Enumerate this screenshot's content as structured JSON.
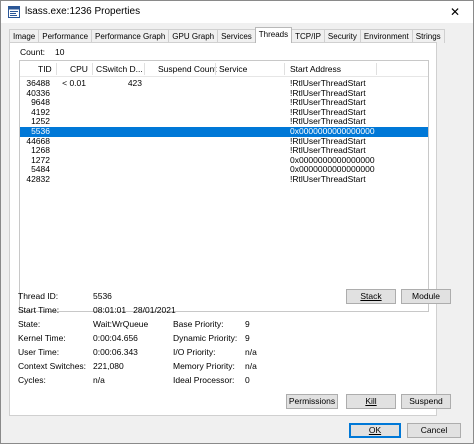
{
  "window": {
    "title": "lsass.exe:1236 Properties",
    "close_glyph": "✕"
  },
  "tabs": [
    {
      "label": "Image",
      "active": false
    },
    {
      "label": "Performance",
      "active": false
    },
    {
      "label": "Performance Graph",
      "active": false
    },
    {
      "label": "GPU Graph",
      "active": false
    },
    {
      "label": "Services",
      "active": false
    },
    {
      "label": "Threads",
      "active": true
    },
    {
      "label": "TCP/IP",
      "active": false
    },
    {
      "label": "Security",
      "active": false
    },
    {
      "label": "Environment",
      "active": false
    },
    {
      "label": "Strings",
      "active": false
    }
  ],
  "count": {
    "label": "Count:",
    "value": "10"
  },
  "columns": {
    "tid": "TID",
    "cpu": "CPU",
    "cswitch": "CSwitch D...",
    "suspend": "Suspend Count",
    "service": "Service",
    "start": "Start Address"
  },
  "threads": [
    {
      "tid": "36488",
      "cpu": "< 0.01",
      "cswitch": "423",
      "start": "!RtlUserThreadStart",
      "selected": false
    },
    {
      "tid": "40336",
      "cpu": "",
      "cswitch": "",
      "start": "!RtlUserThreadStart",
      "selected": false
    },
    {
      "tid": "9648",
      "cpu": "",
      "cswitch": "",
      "start": "!RtlUserThreadStart",
      "selected": false
    },
    {
      "tid": "4192",
      "cpu": "",
      "cswitch": "",
      "start": "!RtlUserThreadStart",
      "selected": false
    },
    {
      "tid": "1252",
      "cpu": "",
      "cswitch": "",
      "start": "!RtlUserThreadStart",
      "selected": false
    },
    {
      "tid": "5536",
      "cpu": "",
      "cswitch": "",
      "start": "0x0000000000000000",
      "selected": true
    },
    {
      "tid": "44668",
      "cpu": "",
      "cswitch": "",
      "start": "!RtlUserThreadStart",
      "selected": false
    },
    {
      "tid": "1268",
      "cpu": "",
      "cswitch": "",
      "start": "!RtlUserThreadStart",
      "selected": false
    },
    {
      "tid": "1272",
      "cpu": "",
      "cswitch": "",
      "start": "0x0000000000000000",
      "selected": false
    },
    {
      "tid": "5484",
      "cpu": "",
      "cswitch": "",
      "start": "0x0000000000000000",
      "selected": false
    },
    {
      "tid": "42832",
      "cpu": "",
      "cswitch": "",
      "start": "!RtlUserThreadStart",
      "selected": false
    }
  ],
  "details": {
    "thread_id": {
      "label": "Thread ID:",
      "value": "5536"
    },
    "start_time": {
      "label": "Start Time:",
      "value": "08:01:01   28/01/2021"
    },
    "state": {
      "label": "State:",
      "value": "Wait:WrQueue"
    },
    "kernel_time": {
      "label": "Kernel Time:",
      "value": "0:00:04.656"
    },
    "user_time": {
      "label": "User Time:",
      "value": "0:00:06.343"
    },
    "context_switches": {
      "label": "Context Switches:",
      "value": "221,080"
    },
    "cycles": {
      "label": "Cycles:",
      "value": "n/a"
    },
    "base_priority": {
      "label": "Base Priority:",
      "value": "9"
    },
    "dynamic_priority": {
      "label": "Dynamic Priority:",
      "value": "9"
    },
    "io_priority": {
      "label": "I/O Priority:",
      "value": "n/a"
    },
    "memory_priority": {
      "label": "Memory Priority:",
      "value": "n/a"
    },
    "ideal_processor": {
      "label": "Ideal Processor:",
      "value": "0"
    }
  },
  "buttons": {
    "stack": "Stack",
    "module": "Module",
    "permissions": "Permissions",
    "kill": "Kill",
    "suspend": "Suspend",
    "ok": "OK",
    "cancel": "Cancel"
  },
  "colors": {
    "selection": "#0078d7"
  }
}
